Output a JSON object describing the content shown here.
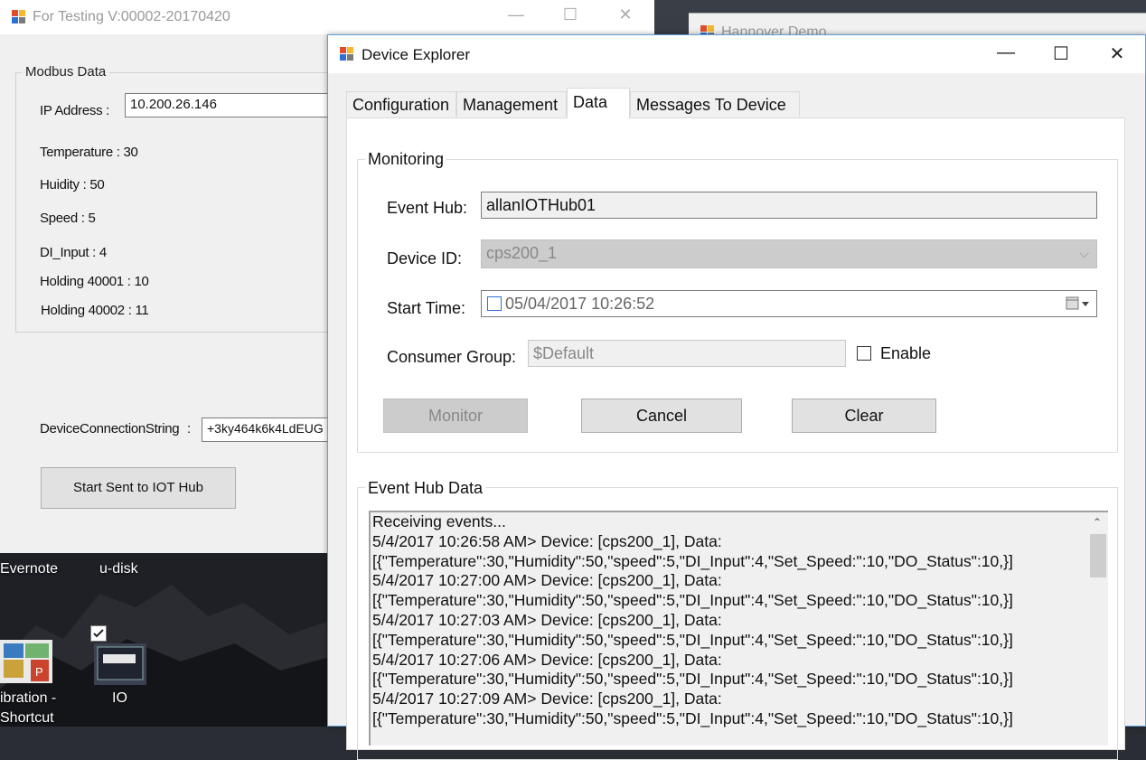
{
  "desktop": {
    "icons": [
      {
        "label": "Evernote"
      },
      {
        "label": "u-disk"
      },
      {
        "label_line1": "ibration -",
        "label_line2": "Shortcut"
      },
      {
        "label": "IO"
      }
    ]
  },
  "hannover": {
    "title": "Hannover Demo"
  },
  "testing": {
    "title": "For Testing V:00002-20170420",
    "modbus_group": "Modbus Data",
    "ip_label": "IP Address :",
    "ip_value": "10.200.26.146",
    "temperature": "Temperature : 30",
    "humidity": "Huidity : 50",
    "speed": "Speed : 5",
    "di_input": "DI_Input : 4",
    "holding1": "Holding 40001 : 10",
    "holding2": "Holding 40002 : 11",
    "conn_label": "DeviceConnectionString",
    "conn_colon": ":",
    "conn_value": "+3ky464k6k4LdEUG",
    "start_button": "Start Sent to IOT Hub"
  },
  "explorer": {
    "title": "Device Explorer",
    "tabs": [
      {
        "label": "Configuration"
      },
      {
        "label": "Management"
      },
      {
        "label": "Data"
      },
      {
        "label": "Messages To Device"
      }
    ],
    "monitoring": {
      "legend": "Monitoring",
      "event_hub_label": "Event Hub:",
      "event_hub_value": "allanIOTHub01",
      "device_id_label": "Device ID:",
      "device_id_value": "cps200_1",
      "start_time_label": "Start Time:",
      "start_time_value": "05/04/2017 10:26:52",
      "consumer_group_label": "Consumer Group:",
      "consumer_group_value": "$Default",
      "enable_label": "Enable",
      "monitor_button": "Monitor",
      "cancel_button": "Cancel",
      "clear_button": "Clear"
    },
    "event_hub_data": {
      "legend": "Event Hub Data",
      "lines": [
        "Receiving events...",
        "5/4/2017 10:26:58 AM> Device: [cps200_1], Data:",
        "[{\"Temperature\":30,\"Humidity\":50,\"speed\":5,\"DI_Input\":4,\"Set_Speed:\":10,\"DO_Status\":10,}]",
        "5/4/2017 10:27:00 AM> Device: [cps200_1], Data:",
        "[{\"Temperature\":30,\"Humidity\":50,\"speed\":5,\"DI_Input\":4,\"Set_Speed:\":10,\"DO_Status\":10,}]",
        "5/4/2017 10:27:03 AM> Device: [cps200_1], Data:",
        "[{\"Temperature\":30,\"Humidity\":50,\"speed\":5,\"DI_Input\":4,\"Set_Speed:\":10,\"DO_Status\":10,}]",
        "5/4/2017 10:27:06 AM> Device: [cps200_1], Data:",
        "[{\"Temperature\":30,\"Humidity\":50,\"speed\":5,\"DI_Input\":4,\"Set_Speed:\":10,\"DO_Status\":10,}]",
        "5/4/2017 10:27:09 AM> Device: [cps200_1], Data:",
        "[{\"Temperature\":30,\"Humidity\":50,\"speed\":5,\"DI_Input\":4,\"Set_Speed:\":10,\"DO_Status\":10,}]"
      ]
    }
  }
}
